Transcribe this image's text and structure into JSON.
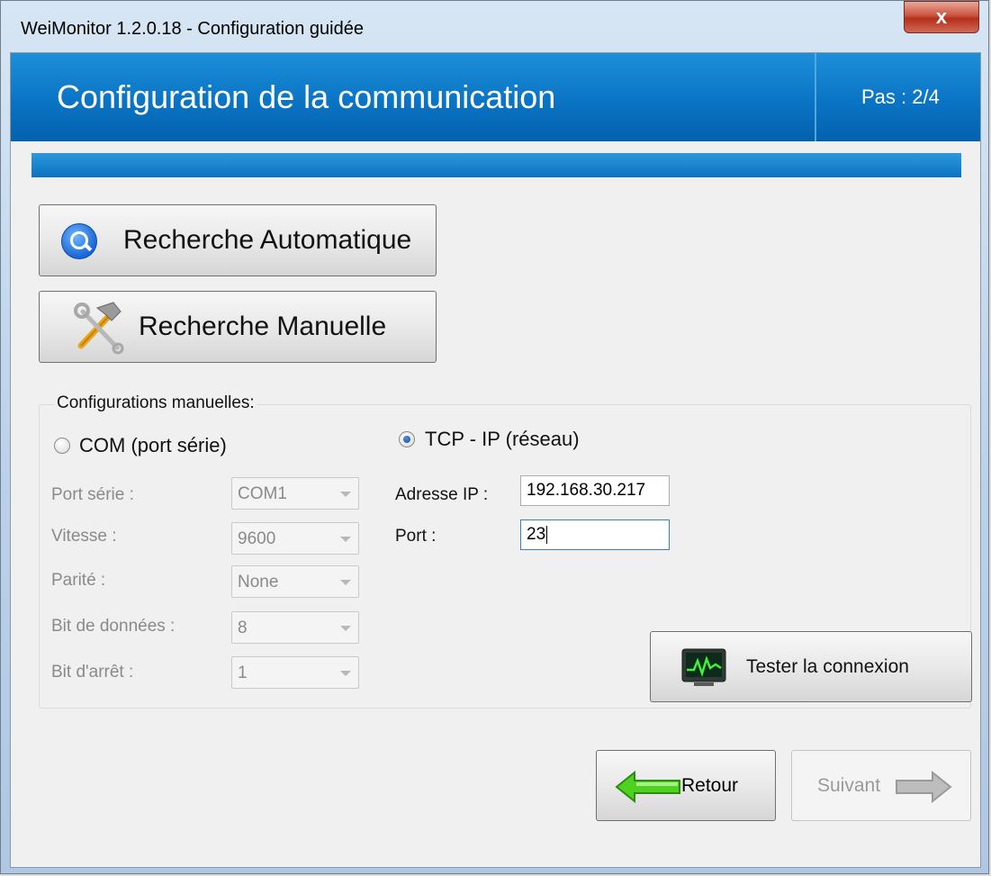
{
  "window": {
    "title": "WeiMonitor 1.2.0.18 - Configuration guidée",
    "close_glyph": "x"
  },
  "header": {
    "title": "Configuration de la communication",
    "step": "Pas : 2/4"
  },
  "actions": {
    "auto_search": "Recherche Automatique",
    "manual_search": "Recherche Manuelle"
  },
  "manual": {
    "group_title": "Configurations manuelles:",
    "com_option": "COM (port série)",
    "tcp_option": "TCP - IP (réseau)",
    "selected": "tcp",
    "serial_fields": [
      {
        "label": "Port série :",
        "value": "COM1"
      },
      {
        "label": "Vitesse :",
        "value": "9600"
      },
      {
        "label": "Parité :",
        "value": "None"
      },
      {
        "label": "Bit de données :",
        "value": "8"
      },
      {
        "label": "Bit d'arrêt :",
        "value": "1"
      }
    ],
    "ip_label": "Adresse IP :",
    "ip_value": "192.168.30.217",
    "port_label": "Port :",
    "port_value": "23",
    "test_button": "Tester la connexion"
  },
  "navigation": {
    "back": "Retour",
    "next": "Suivant",
    "next_enabled": false
  },
  "colors": {
    "banner_blue": "#0a74c4",
    "arrow_green": "#3fc21a",
    "arrow_gray": "#a9a9a9"
  }
}
